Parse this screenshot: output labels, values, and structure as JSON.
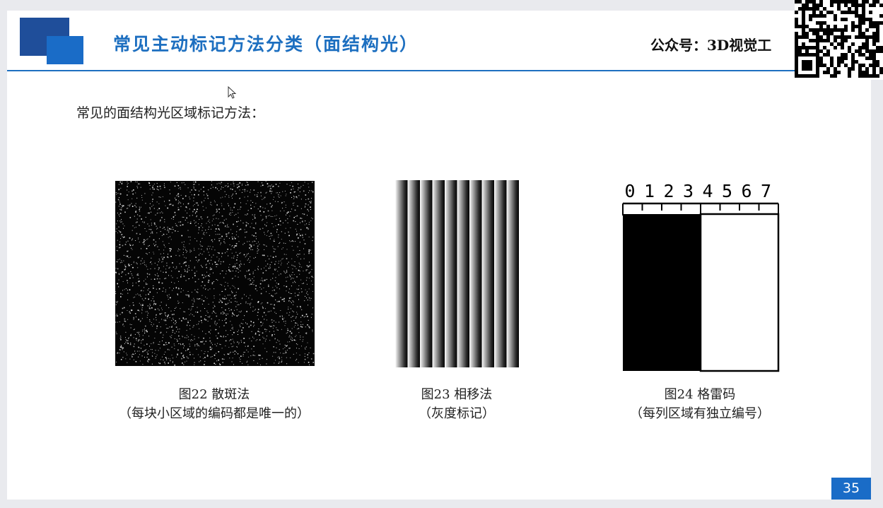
{
  "slide": {
    "title": "常见主动标记方法分类（面结构光）",
    "account": "公众号：3D视觉工",
    "intro": "常见的面结构光区域标记方法：",
    "page_number": "35"
  },
  "figures": [
    {
      "id": "fig22",
      "caption": "图22 散斑法",
      "note": "（每块小区域的编码都是唯一的）"
    },
    {
      "id": "fig23",
      "caption": "图23 相移法",
      "note": "（灰度标记）"
    },
    {
      "id": "fig24",
      "caption": "图24 格雷码",
      "note": "（每列区域有独立编号）",
      "scale_labels": [
        "0",
        "1",
        "2",
        "3",
        "4",
        "5",
        "6",
        "7"
      ]
    }
  ],
  "colors": {
    "accent": "#1d6fc0",
    "logo_dark": "#1f4e9a",
    "logo_light": "#1a6cc7"
  },
  "icons": [
    "cursor-icon",
    "qr-code-icon",
    "logo-icon"
  ]
}
